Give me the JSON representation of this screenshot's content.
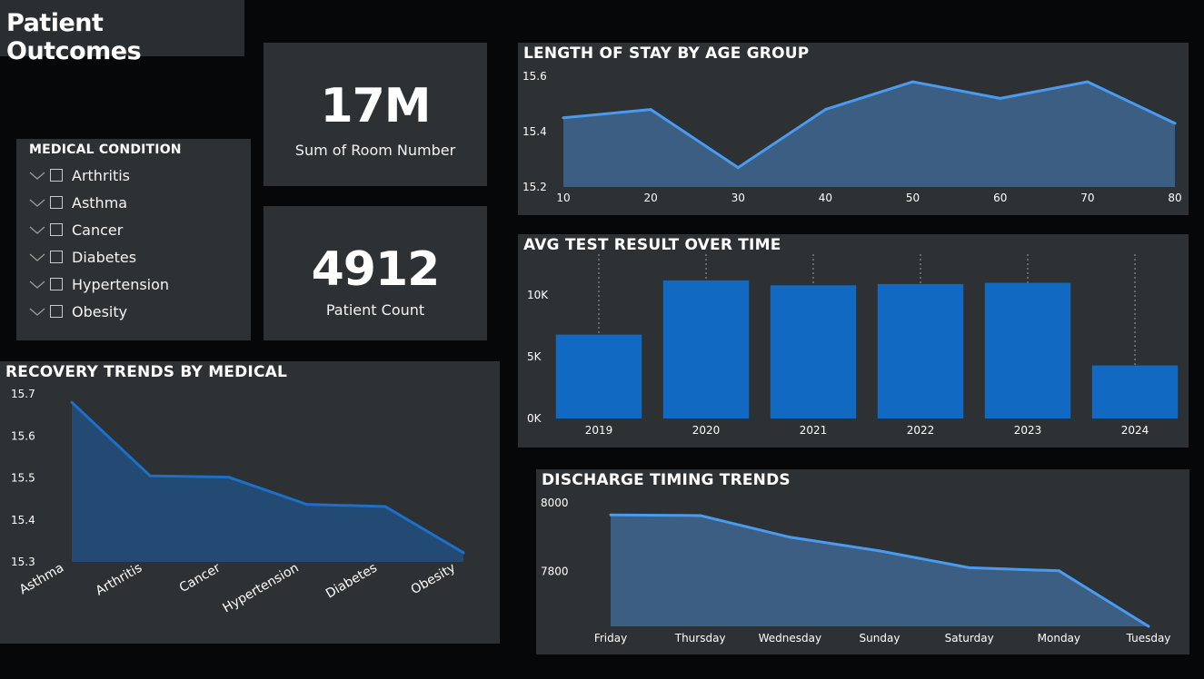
{
  "page": {
    "title": "Patient Outcomes"
  },
  "kpis": {
    "room": {
      "value": "17M",
      "label": "Sum of Room Number"
    },
    "patients": {
      "value": "4912",
      "label": "Patient Count"
    }
  },
  "slicer": {
    "title": "MEDICAL CONDITION",
    "items": [
      {
        "label": "Arthritis",
        "checked": false
      },
      {
        "label": "Asthma",
        "checked": false
      },
      {
        "label": "Cancer",
        "checked": false
      },
      {
        "label": "Diabetes",
        "checked": false
      },
      {
        "label": "Hypertension",
        "checked": false
      },
      {
        "label": "Obesity",
        "checked": false
      }
    ]
  },
  "chart_data": [
    {
      "id": "los",
      "type": "area",
      "title": "LENGTH OF STAY BY AGE GROUP",
      "x": [
        10,
        20,
        30,
        40,
        50,
        60,
        70,
        80
      ],
      "values": [
        15.45,
        15.48,
        15.27,
        15.48,
        15.58,
        15.52,
        15.58,
        15.43
      ],
      "ylim": [
        15.2,
        15.6
      ],
      "yticks": [
        15.2,
        15.4,
        15.6
      ],
      "color": "#4a9bf0",
      "grid": false
    },
    {
      "id": "test",
      "type": "bar",
      "title": "AVG TEST RESULT OVER TIME",
      "categories": [
        "2019",
        "2020",
        "2021",
        "2022",
        "2023",
        "2024"
      ],
      "values": [
        6800,
        11200,
        10800,
        10900,
        11000,
        4300
      ],
      "ylim": [
        0,
        12000
      ],
      "yticks": [
        0,
        5000,
        10000
      ],
      "ytick_labels": [
        "0K",
        "5K",
        "10K"
      ],
      "color": "#1169c2",
      "grid": false
    },
    {
      "id": "recovery",
      "type": "area",
      "title": "RECOVERY TRENDS BY MEDICAL",
      "categories": [
        "Asthma",
        "Arthritis",
        "Cancer",
        "Hypertension",
        "Diabetes",
        "Obesity"
      ],
      "values": [
        15.68,
        15.505,
        15.502,
        15.437,
        15.432,
        15.322
      ],
      "ylim": [
        15.3,
        15.7
      ],
      "yticks": [
        15.3,
        15.4,
        15.5,
        15.6,
        15.7
      ],
      "color": "#1d6fc7",
      "grid": false
    },
    {
      "id": "discharge",
      "type": "area",
      "title": "DISCHARGE TIMING TRENDS",
      "categories": [
        "Friday",
        "Thursday",
        "Wednesday",
        "Sunday",
        "Saturday",
        "Monday",
        "Tuesday"
      ],
      "values": [
        7965,
        7963,
        7900,
        7860,
        7811,
        7802,
        7640
      ],
      "ylim": [
        7640,
        8000
      ],
      "yticks": [
        7800,
        8000
      ],
      "color": "#4a9bf0",
      "grid": false
    }
  ]
}
